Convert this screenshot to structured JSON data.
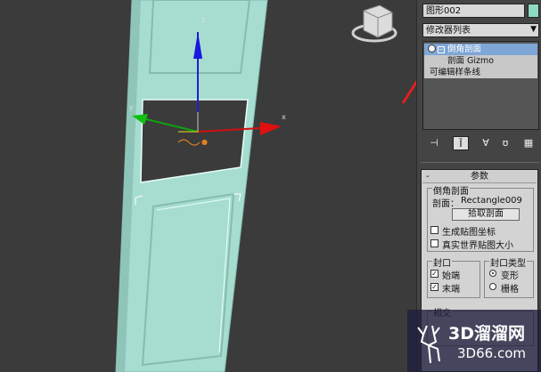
{
  "viewport": {
    "gizmo": {
      "axis_x": "x",
      "axis_y": "y",
      "axis_z": "z"
    }
  },
  "panel": {
    "object_name": "图形002",
    "object_color": "#8fd8c4",
    "modifier_list": "修改器列表",
    "stack": {
      "items": [
        {
          "label": "倒角剖面"
        },
        {
          "label": "剖面 Gizmo"
        },
        {
          "label": "可编辑样条线"
        }
      ]
    },
    "tools": [
      "pin-icon",
      "show-end-result-icon",
      "make-unique-icon",
      "remove-modifier-icon",
      "configure-icon"
    ]
  },
  "params": {
    "header": "参数",
    "group_title": "倒角剖面",
    "profile_label": "剖面：",
    "profile_value": "Rectangle009",
    "pick_button": "拾取剖面",
    "gen_mapping": "生成贴图坐标",
    "real_world": "真实世界贴图大小",
    "cap_group": "封口",
    "cap_start": "始端",
    "cap_end": "末端",
    "cap_type_group": "封口类型",
    "cap_morph": "变形",
    "cap_grid": "栅格",
    "next_group": "相交"
  },
  "watermark": {
    "title": "3D溜溜网",
    "sub": "3D66.com"
  },
  "colors": {
    "door": "#a6ddd0",
    "selection": "#7ea6d6",
    "annotation_arrow": "#e02020"
  }
}
